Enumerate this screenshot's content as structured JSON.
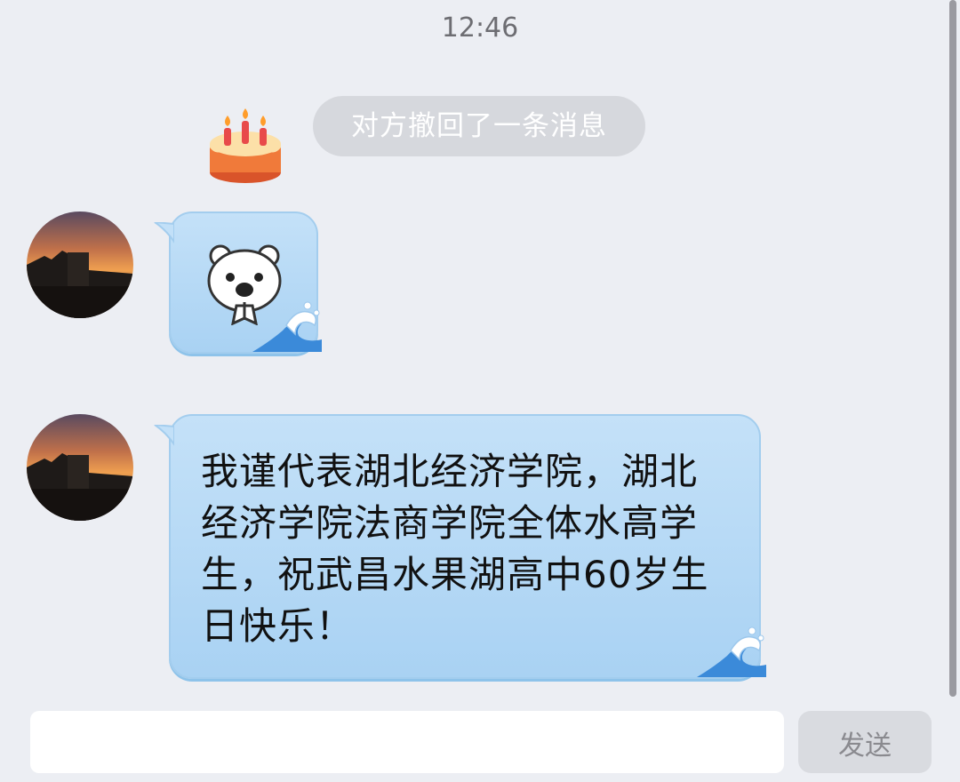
{
  "timestamp": "12:46",
  "system_notice": {
    "icon": "birthday-cake-icon",
    "text": "对方撤回了一条消息"
  },
  "messages": [
    {
      "type": "sticker",
      "sticker": "polar-bear-praying-sticker"
    },
    {
      "type": "text",
      "text": "我谨代表湖北经济学院，湖北经济学院法商学院全体水高学生，祝武昌水果湖高中60岁生日快乐！"
    }
  ],
  "composer": {
    "input_value": "",
    "send_label": "发送"
  },
  "colors": {
    "background": "#eceef3",
    "bubble": "#b4d8f5",
    "recall_pill": "#d6d8dd"
  }
}
